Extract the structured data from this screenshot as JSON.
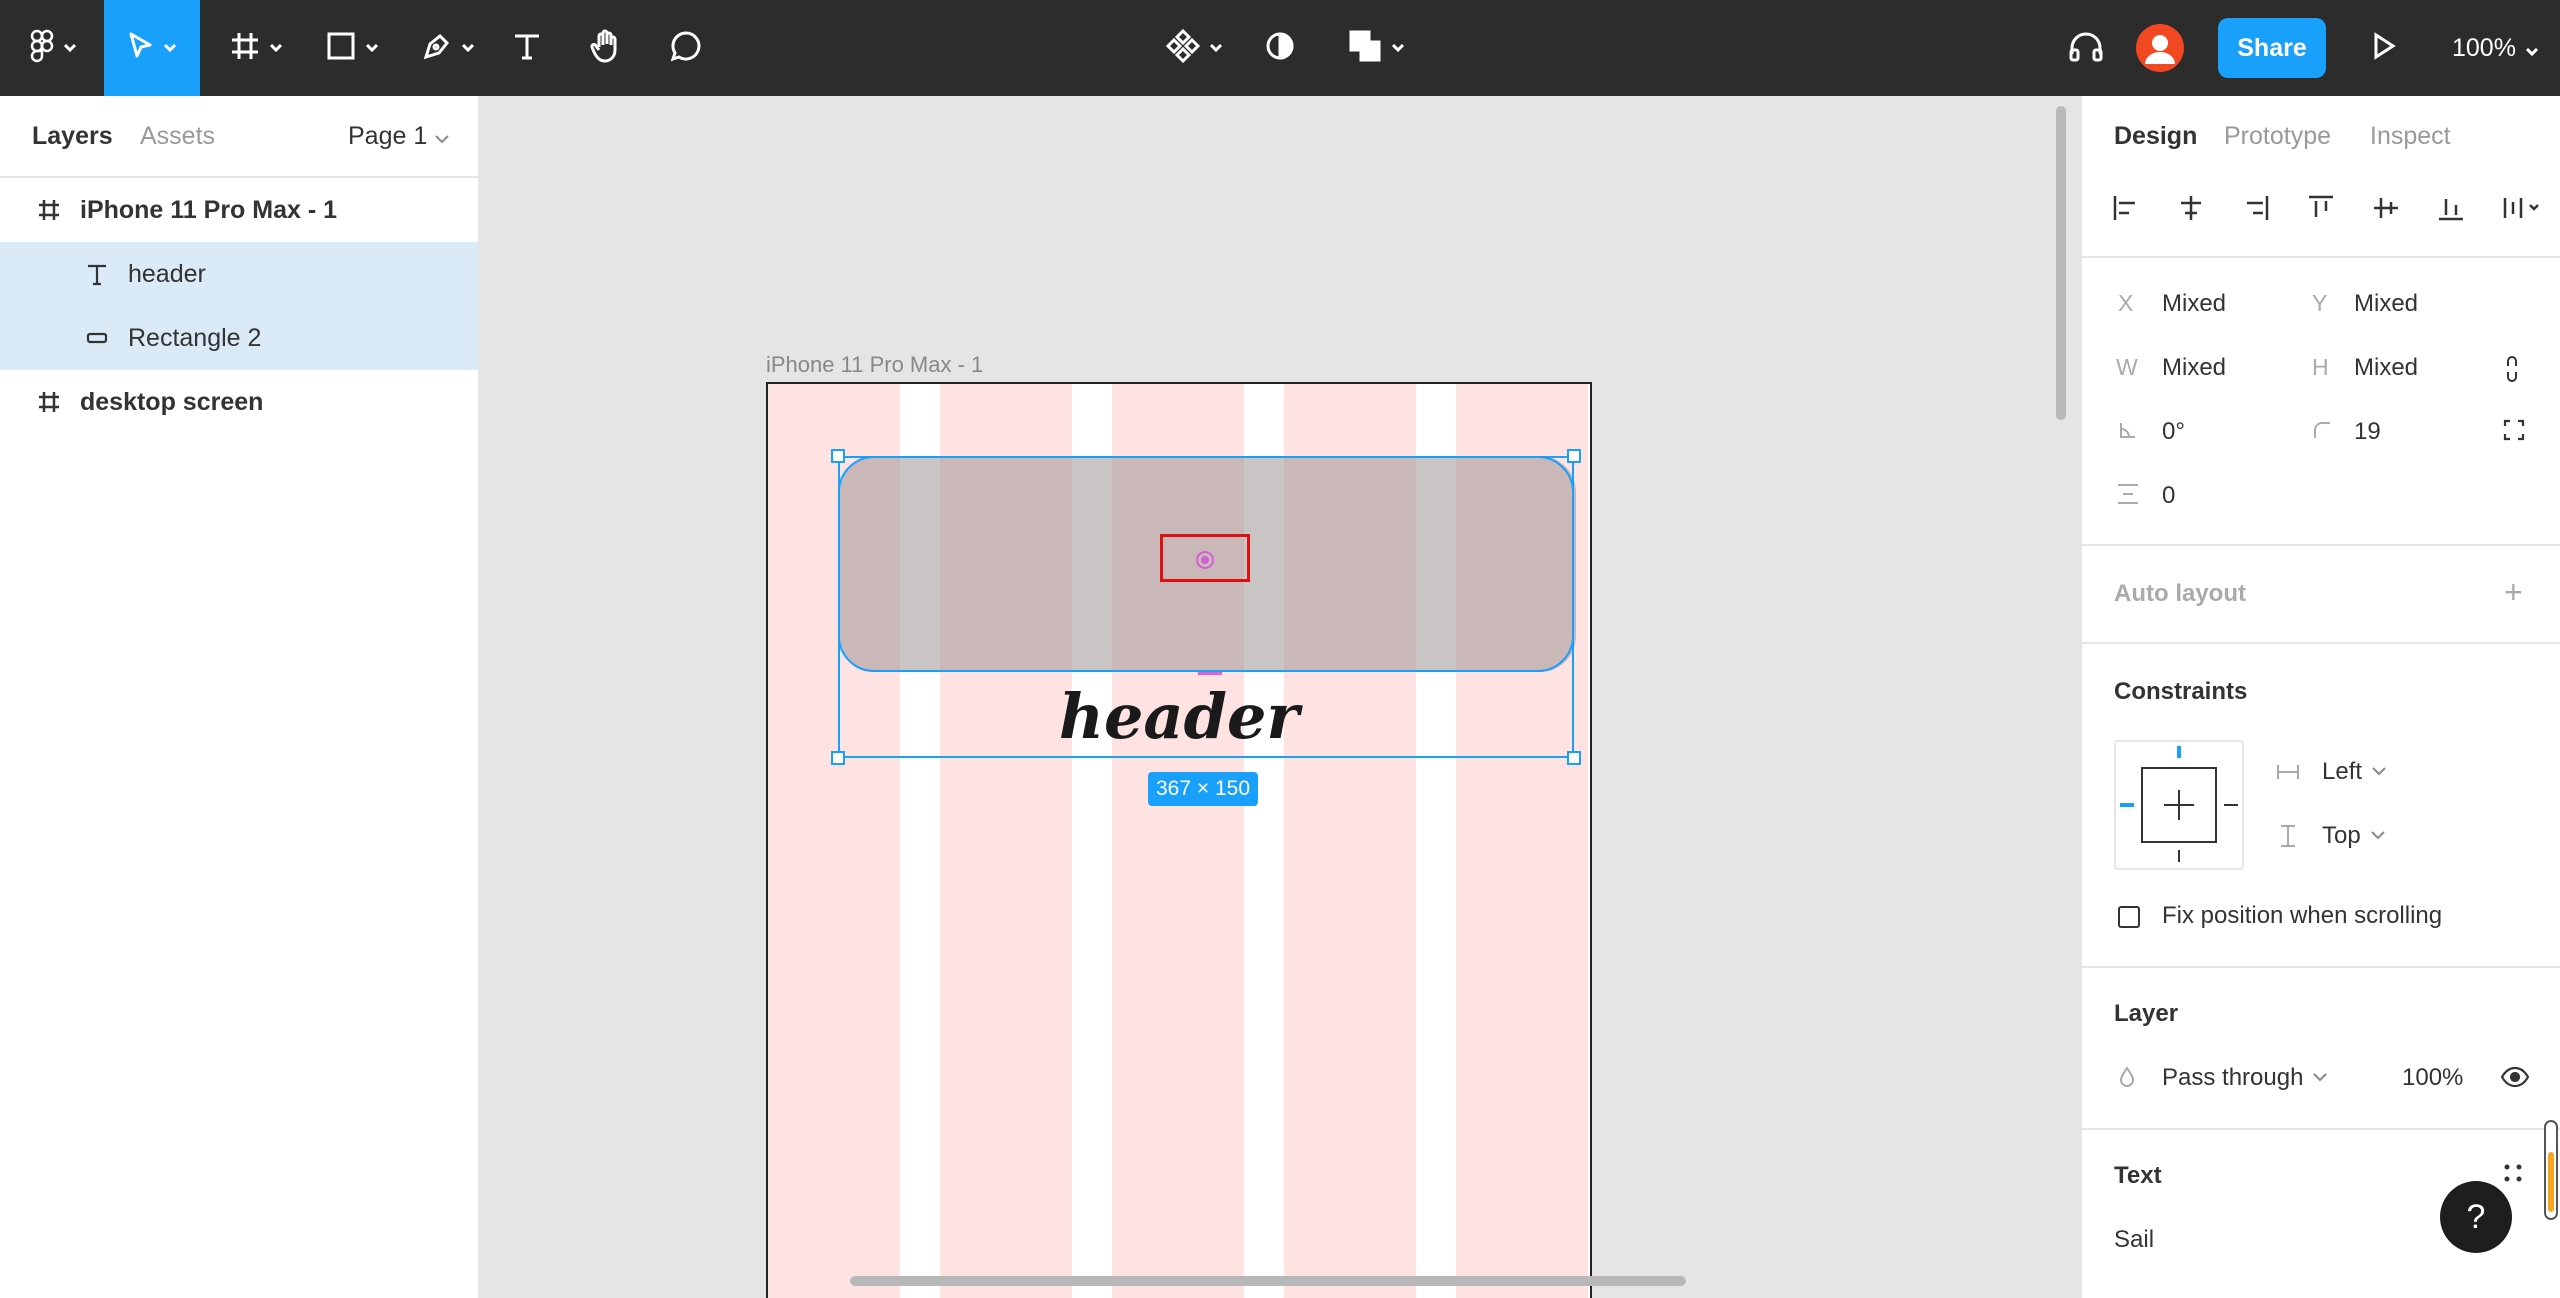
{
  "toolbar": {
    "tools": [
      "figma-menu",
      "move",
      "frame",
      "shape",
      "pen",
      "text",
      "hand",
      "comment"
    ],
    "share_label": "Share",
    "zoom": "100%"
  },
  "left_panel": {
    "tabs": [
      {
        "label": "Layers",
        "active": true
      },
      {
        "label": "Assets",
        "active": false
      }
    ],
    "page": "Page 1",
    "layers": [
      {
        "name": "iPhone 11 Pro Max - 1",
        "type": "frame",
        "selected": false
      },
      {
        "name": "header",
        "type": "text",
        "selected": true
      },
      {
        "name": "Rectangle 2",
        "type": "rectangle",
        "selected": true
      },
      {
        "name": "desktop screen",
        "type": "frame",
        "selected": false
      }
    ]
  },
  "canvas": {
    "frame_label": "iPhone 11 Pro Max - 1",
    "header_text": "header",
    "size_badge": "367 × 150"
  },
  "right_panel": {
    "tabs": [
      {
        "label": "Design",
        "active": true
      },
      {
        "label": "Prototype",
        "active": false
      },
      {
        "label": "Inspect",
        "active": false
      }
    ],
    "x_label": "X",
    "x_value": "Mixed",
    "y_label": "Y",
    "y_value": "Mixed",
    "w_label": "W",
    "w_value": "Mixed",
    "h_label": "H",
    "h_value": "Mixed",
    "rotation": "0°",
    "radius": "19",
    "spacing": "0",
    "auto_layout_title": "Auto layout",
    "constraints_title": "Constraints",
    "constraint_h": "Left",
    "constraint_v": "Top",
    "fix_position_label": "Fix position when scrolling",
    "layer_title": "Layer",
    "blend_mode": "Pass through",
    "opacity": "100%",
    "text_title": "Text",
    "font_name": "Sail"
  },
  "colors": {
    "toolbar_bg": "#2c2c2c",
    "accent": "#18a0fb",
    "selection_bg": "#daebf7",
    "layout_grid": "#ffe3e3",
    "avatar": "#f24822"
  }
}
